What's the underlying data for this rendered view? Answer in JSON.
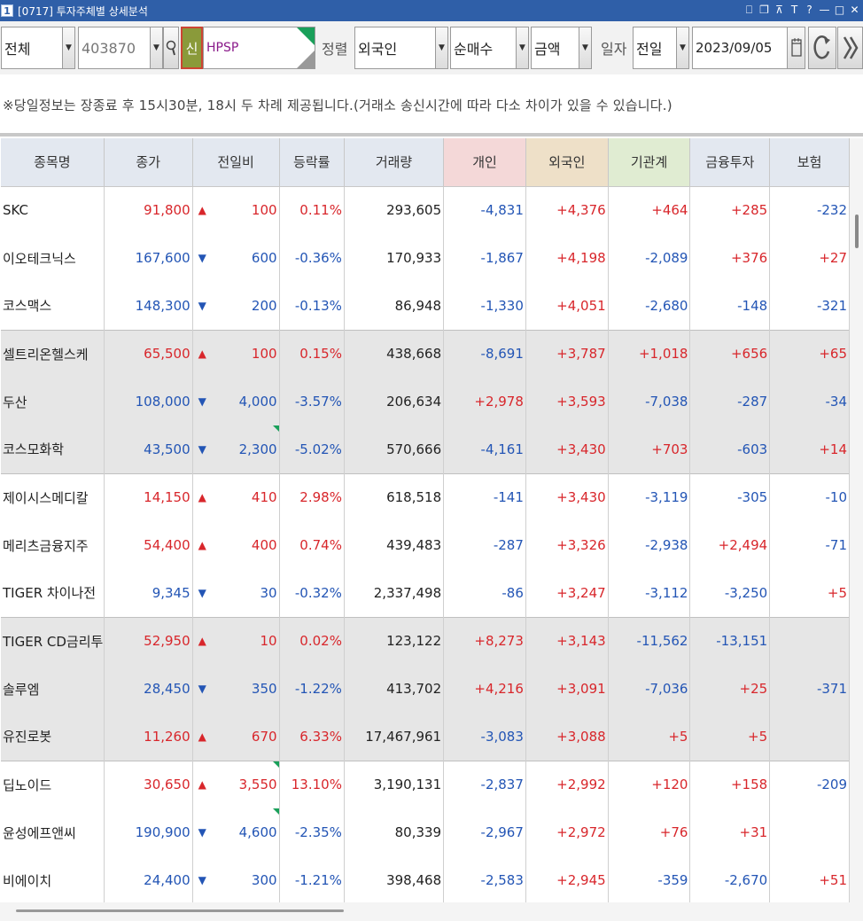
{
  "window": {
    "number": "1",
    "title": "[0717] 투자주체별 상세분석",
    "controls": [
      "⎕",
      "❐",
      "⊼",
      "T",
      "?",
      "—",
      "□",
      "✕"
    ]
  },
  "toolbar": {
    "market": "전체",
    "code": "403870",
    "new_badge": "신",
    "stock_name": "HPSP",
    "sort_label": "정렬",
    "investor": "외국인",
    "mode": "순매수",
    "unit": "금액",
    "date_label": "일자",
    "period": "전일",
    "date": "2023/09/05"
  },
  "notice": "※당일정보는 장종료 후 15시30분, 18시 두 차례 제공됩니다.(거래소 송신시간에 따라 다소 차이가 있을 수 있습니다.)",
  "table": {
    "headers": [
      "종목명",
      "종가",
      "전일비",
      "등락률",
      "거래량",
      "개인",
      "외국인",
      "기관계",
      "금융투자",
      "보험"
    ],
    "rows": [
      {
        "name": "SKC",
        "price": "91,800",
        "dir": "up",
        "change": "100",
        "rate": "0.11%",
        "volume": "293,605",
        "indiv": "-4,831",
        "foreign": "+4,376",
        "inst": "+464",
        "fininv": "+285",
        "insur": "-232",
        "group": 1,
        "flag": false
      },
      {
        "name": "이오테크닉스",
        "price": "167,600",
        "dir": "dn",
        "change": "600",
        "rate": "-0.36%",
        "volume": "170,933",
        "indiv": "-1,867",
        "foreign": "+4,198",
        "inst": "-2,089",
        "fininv": "+376",
        "insur": "+27",
        "group": 1,
        "flag": false
      },
      {
        "name": "코스맥스",
        "price": "148,300",
        "dir": "dn",
        "change": "200",
        "rate": "-0.13%",
        "volume": "86,948",
        "indiv": "-1,330",
        "foreign": "+4,051",
        "inst": "-2,680",
        "fininv": "-148",
        "insur": "-321",
        "group": 1,
        "flag": false
      },
      {
        "name": "셀트리온헬스케",
        "price": "65,500",
        "dir": "up",
        "change": "100",
        "rate": "0.15%",
        "volume": "438,668",
        "indiv": "-8,691",
        "foreign": "+3,787",
        "inst": "+1,018",
        "fininv": "+656",
        "insur": "+65",
        "group": 2,
        "flag": false
      },
      {
        "name": "두산",
        "price": "108,000",
        "dir": "dn",
        "change": "4,000",
        "rate": "-3.57%",
        "volume": "206,634",
        "indiv": "+2,978",
        "foreign": "+3,593",
        "inst": "-7,038",
        "fininv": "-287",
        "insur": "-34",
        "group": 2,
        "flag": false
      },
      {
        "name": "코스모화학",
        "price": "43,500",
        "dir": "dn",
        "change": "2,300",
        "rate": "-5.02%",
        "volume": "570,666",
        "indiv": "-4,161",
        "foreign": "+3,430",
        "inst": "+703",
        "fininv": "-603",
        "insur": "+14",
        "group": 2,
        "flag": true
      },
      {
        "name": "제이시스메디칼",
        "price": "14,150",
        "dir": "up",
        "change": "410",
        "rate": "2.98%",
        "volume": "618,518",
        "indiv": "-141",
        "foreign": "+3,430",
        "inst": "-3,119",
        "fininv": "-305",
        "insur": "-10",
        "group": 1,
        "flag": false
      },
      {
        "name": "메리츠금융지주",
        "price": "54,400",
        "dir": "up",
        "change": "400",
        "rate": "0.74%",
        "volume": "439,483",
        "indiv": "-287",
        "foreign": "+3,326",
        "inst": "-2,938",
        "fininv": "+2,494",
        "insur": "-71",
        "group": 1,
        "flag": false
      },
      {
        "name": "TIGER 차이나전",
        "price": "9,345",
        "dir": "dn",
        "change": "30",
        "rate": "-0.32%",
        "volume": "2,337,498",
        "indiv": "-86",
        "foreign": "+3,247",
        "inst": "-3,112",
        "fininv": "-3,250",
        "insur": "+5",
        "group": 1,
        "flag": false
      },
      {
        "name": "TIGER CD금리투",
        "price": "52,950",
        "dir": "up",
        "change": "10",
        "rate": "0.02%",
        "volume": "123,122",
        "indiv": "+8,273",
        "foreign": "+3,143",
        "inst": "-11,562",
        "fininv": "-13,151",
        "insur": "",
        "group": 2,
        "flag": false
      },
      {
        "name": "솔루엠",
        "price": "28,450",
        "dir": "dn",
        "change": "350",
        "rate": "-1.22%",
        "volume": "413,702",
        "indiv": "+4,216",
        "foreign": "+3,091",
        "inst": "-7,036",
        "fininv": "+25",
        "insur": "-371",
        "group": 2,
        "flag": false
      },
      {
        "name": "유진로봇",
        "price": "11,260",
        "dir": "up",
        "change": "670",
        "rate": "6.33%",
        "volume": "17,467,961",
        "indiv": "-3,083",
        "foreign": "+3,088",
        "inst": "+5",
        "fininv": "+5",
        "insur": "",
        "group": 2,
        "flag": false
      },
      {
        "name": "딥노이드",
        "price": "30,650",
        "dir": "up",
        "change": "3,550",
        "rate": "13.10%",
        "volume": "3,190,131",
        "indiv": "-2,837",
        "foreign": "+2,992",
        "inst": "+120",
        "fininv": "+158",
        "insur": "-209",
        "group": 1,
        "flag": true
      },
      {
        "name": "윤성에프앤씨",
        "price": "190,900",
        "dir": "dn",
        "change": "4,600",
        "rate": "-2.35%",
        "volume": "80,339",
        "indiv": "-2,967",
        "foreign": "+2,972",
        "inst": "+76",
        "fininv": "+31",
        "insur": "",
        "group": 1,
        "flag": true
      },
      {
        "name": "비에이치",
        "price": "24,400",
        "dir": "dn",
        "change": "300",
        "rate": "-1.21%",
        "volume": "398,468",
        "indiv": "-2,583",
        "foreign": "+2,945",
        "inst": "-359",
        "fininv": "-2,670",
        "insur": "+51",
        "group": 1,
        "flag": false
      }
    ]
  },
  "colors": {
    "titlebar": "#2f5fa8",
    "up": "#d8262b",
    "down": "#2355b5",
    "header_indiv": "#f4d8d8",
    "header_foreign": "#eee0c8",
    "header_inst": "#e0ecd2"
  }
}
